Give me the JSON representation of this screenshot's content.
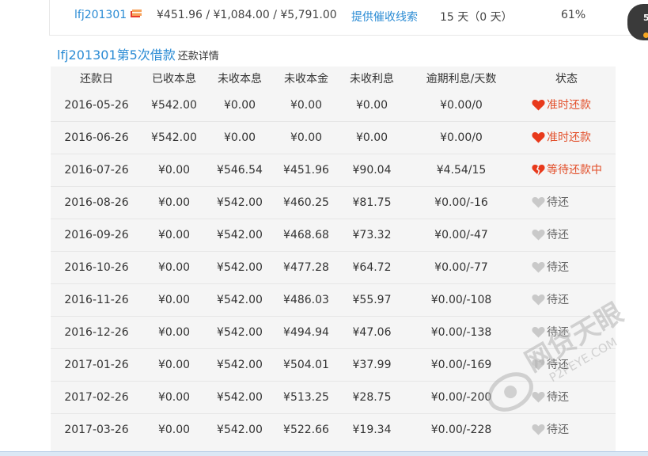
{
  "top_row": {
    "username": "lfj201301",
    "amounts": "¥451.96 / ¥1,084.00 / ¥5,791.00",
    "link": "提供催收线索",
    "days": "15 天（0 天）",
    "percent": "61%"
  },
  "side_badge": {
    "number": "5"
  },
  "detail": {
    "title": "lfj201301第5次借款",
    "subtitle": "还款详情"
  },
  "table": {
    "headers": [
      "还款日",
      "已收本息",
      "未收本息",
      "未收本金",
      "未收利息",
      "逾期利息/天数",
      "状态"
    ],
    "rows": [
      {
        "date": "2016-05-26",
        "received": "¥542.00",
        "unreceived": "¥0.00",
        "principal": "¥0.00",
        "interest": "¥0.00",
        "overdue": "¥0.00/0",
        "status": "准时还款",
        "status_icon": "heart-icon"
      },
      {
        "date": "2016-06-26",
        "received": "¥542.00",
        "unreceived": "¥0.00",
        "principal": "¥0.00",
        "interest": "¥0.00",
        "overdue": "¥0.00/0",
        "status": "准时还款",
        "status_icon": "heart-icon"
      },
      {
        "date": "2016-07-26",
        "received": "¥0.00",
        "unreceived": "¥546.54",
        "principal": "¥451.96",
        "interest": "¥90.04",
        "overdue": "¥4.54/15",
        "status": "等待还款中",
        "status_icon": "broken-heart-icon"
      },
      {
        "date": "2016-08-26",
        "received": "¥0.00",
        "unreceived": "¥542.00",
        "principal": "¥460.25",
        "interest": "¥81.75",
        "overdue": "¥0.00/-16",
        "status": "待还",
        "status_icon": "grey-heart-icon"
      },
      {
        "date": "2016-09-26",
        "received": "¥0.00",
        "unreceived": "¥542.00",
        "principal": "¥468.68",
        "interest": "¥73.32",
        "overdue": "¥0.00/-47",
        "status": "待还",
        "status_icon": "grey-heart-icon"
      },
      {
        "date": "2016-10-26",
        "received": "¥0.00",
        "unreceived": "¥542.00",
        "principal": "¥477.28",
        "interest": "¥64.72",
        "overdue": "¥0.00/-77",
        "status": "待还",
        "status_icon": "grey-heart-icon"
      },
      {
        "date": "2016-11-26",
        "received": "¥0.00",
        "unreceived": "¥542.00",
        "principal": "¥486.03",
        "interest": "¥55.97",
        "overdue": "¥0.00/-108",
        "status": "待还",
        "status_icon": "grey-heart-icon"
      },
      {
        "date": "2016-12-26",
        "received": "¥0.00",
        "unreceived": "¥542.00",
        "principal": "¥494.94",
        "interest": "¥47.06",
        "overdue": "¥0.00/-138",
        "status": "待还",
        "status_icon": "grey-heart-icon"
      },
      {
        "date": "2017-01-26",
        "received": "¥0.00",
        "unreceived": "¥542.00",
        "principal": "¥504.01",
        "interest": "¥37.99",
        "overdue": "¥0.00/-169",
        "status": "待还",
        "status_icon": "grey-heart-icon"
      },
      {
        "date": "2017-02-26",
        "received": "¥0.00",
        "unreceived": "¥542.00",
        "principal": "¥513.25",
        "interest": "¥28.75",
        "overdue": "¥0.00/-200",
        "status": "待还",
        "status_icon": "grey-heart-icon"
      },
      {
        "date": "2017-03-26",
        "received": "¥0.00",
        "unreceived": "¥542.00",
        "principal": "¥522.66",
        "interest": "¥19.34",
        "overdue": "¥0.00/-228",
        "status": "待还",
        "status_icon": "grey-heart-icon"
      }
    ]
  },
  "watermark": {
    "text": "网贷天眼",
    "url": "P2PEYE.COM"
  },
  "colors": {
    "link_blue": "#2a8bd4",
    "heart_red": "#e8391b",
    "status_red": "#e24f2a",
    "heart_grey": "#c9c9c9",
    "table_bg": "#f5f5f5",
    "watermark_grey": "#b3b3b3"
  }
}
